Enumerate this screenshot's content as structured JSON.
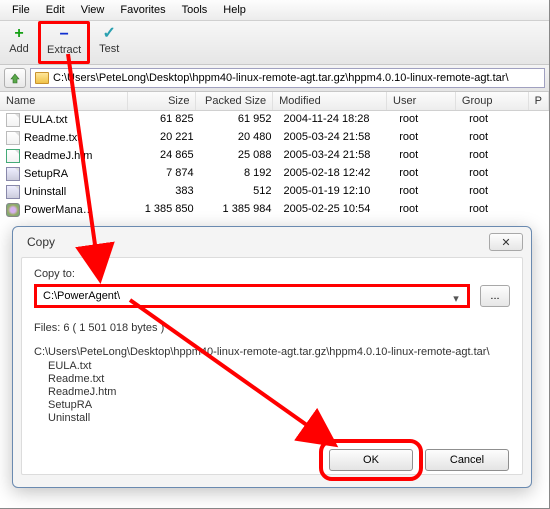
{
  "menubar": [
    "File",
    "Edit",
    "View",
    "Favorites",
    "Tools",
    "Help"
  ],
  "toolbar": {
    "add": {
      "label": "Add",
      "glyph": "+",
      "color": "#15a015"
    },
    "extract": {
      "label": "Extract",
      "glyph": "−",
      "color": "#1030d0"
    },
    "test": {
      "label": "Test",
      "glyph": "✓",
      "color": "#2aa0b0"
    }
  },
  "address": {
    "path": "C:\\Users\\PeteLong\\Desktop\\hppm40-linux-remote-agt.tar.gz\\hppm4.0.10-linux-remote-agt.tar\\"
  },
  "columns": {
    "name": "Name",
    "size": "Size",
    "packed": "Packed Size",
    "modified": "Modified",
    "user": "User",
    "group": "Group",
    "extra": "P"
  },
  "files": [
    {
      "icon": "file",
      "name": "EULA.txt",
      "size": "61 825",
      "packed": "61 952",
      "modified": "2004-11-24 18:28",
      "user": "root",
      "group": "root"
    },
    {
      "icon": "file",
      "name": "Readme.txt",
      "size": "20 221",
      "packed": "20 480",
      "modified": "2005-03-24 21:58",
      "user": "root",
      "group": "root"
    },
    {
      "icon": "htm",
      "name": "ReadmeJ.htm",
      "size": "24 865",
      "packed": "25 088",
      "modified": "2005-03-24 21:58",
      "user": "root",
      "group": "root"
    },
    {
      "icon": "exe",
      "name": "SetupRA",
      "size": "7 874",
      "packed": "8 192",
      "modified": "2005-02-18 12:42",
      "user": "root",
      "group": "root"
    },
    {
      "icon": "exe",
      "name": "Uninstall",
      "size": "383",
      "packed": "512",
      "modified": "2005-01-19 12:10",
      "user": "root",
      "group": "root"
    },
    {
      "icon": "cog",
      "name": "PowerMana…",
      "size": "1 385 850",
      "packed": "1 385 984",
      "modified": "2005-02-25 10:54",
      "user": "root",
      "group": "root"
    }
  ],
  "dialog": {
    "title": "Copy",
    "copy_to_label": "Copy to:",
    "dest": "C:\\PowerAgent\\",
    "summary": "Files: 6   ( 1 501 018 bytes )",
    "source_path": "C:\\Users\\PeteLong\\Desktop\\hppm40-linux-remote-agt.tar.gz\\hppm4.0.10-linux-remote-agt.tar\\",
    "items": [
      "EULA.txt",
      "Readme.txt",
      "ReadmeJ.htm",
      "SetupRA",
      "Uninstall"
    ],
    "ok": "OK",
    "cancel": "Cancel",
    "browse": "..."
  }
}
